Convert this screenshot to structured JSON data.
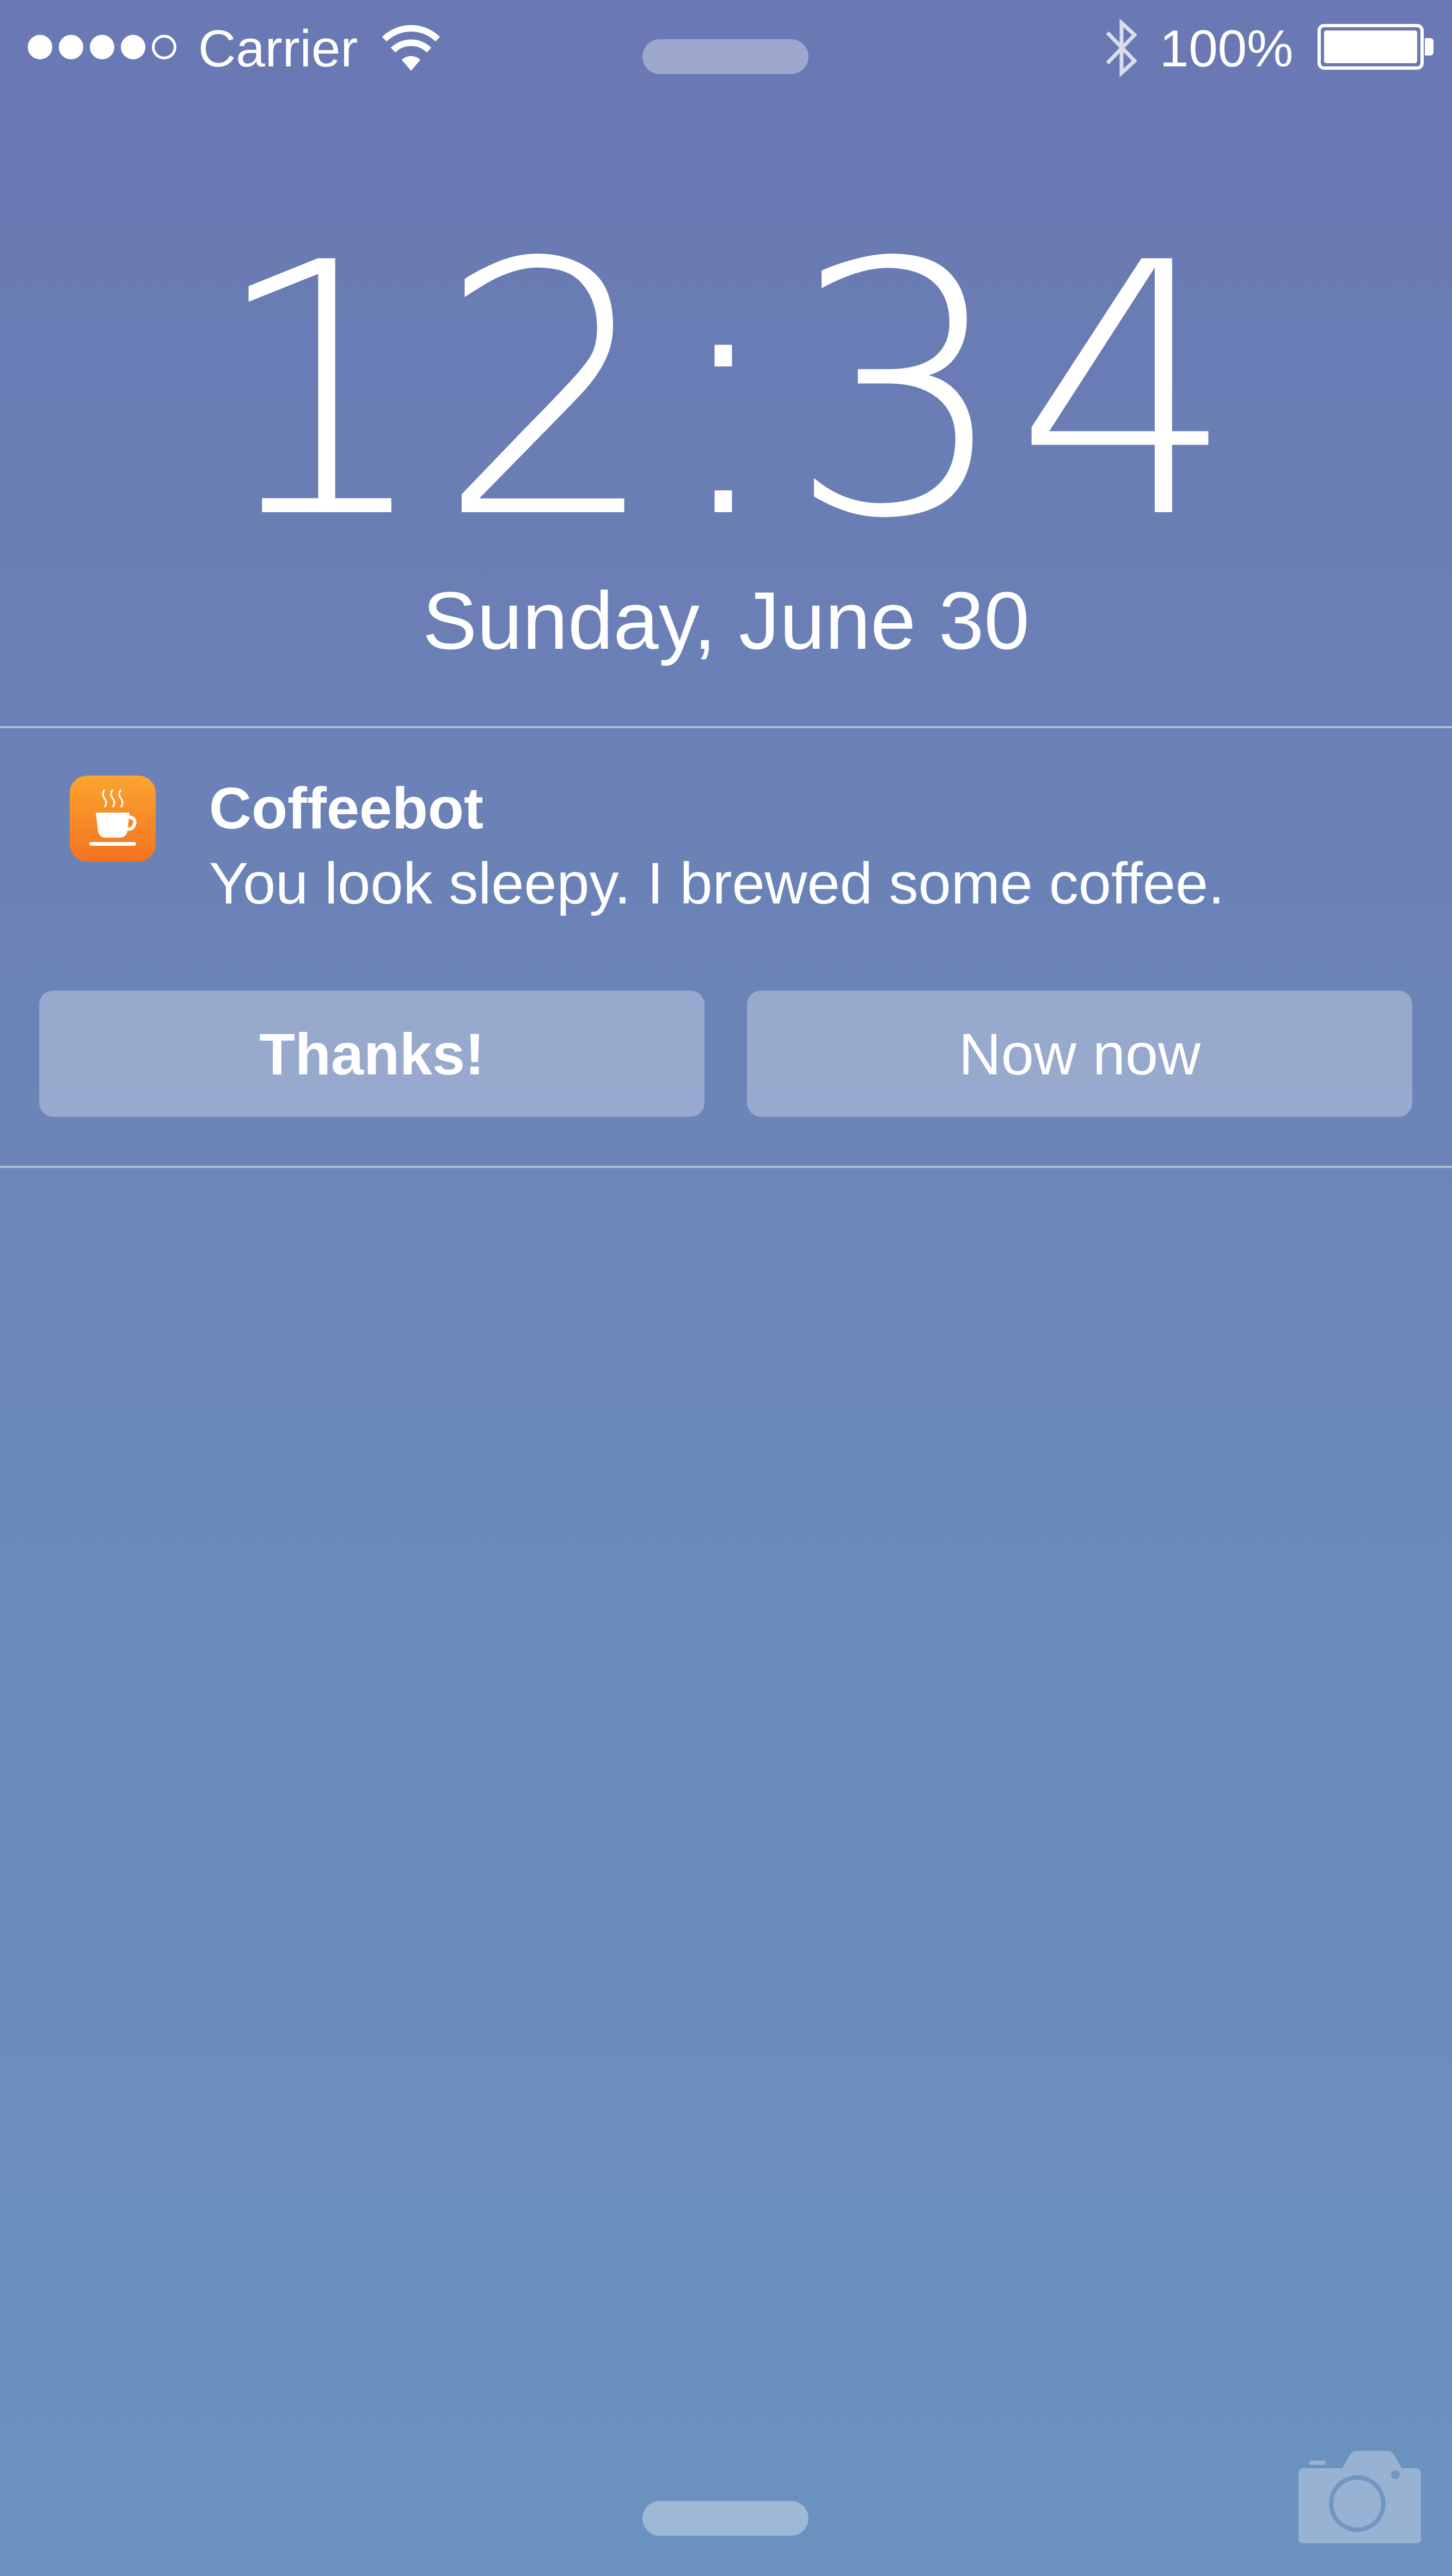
{
  "status_bar": {
    "signal_filled": 4,
    "signal_total": 5,
    "carrier": "Carrier",
    "battery_percent": "100%",
    "battery_level": 1.0
  },
  "lock_screen": {
    "time": "12:34",
    "date": "Sunday, June 30"
  },
  "notification": {
    "app_name": "Coffeebot",
    "message": "You look sleepy. I brewed some coffee.",
    "icon": "coffee-cup-icon",
    "actions": [
      {
        "label": "Thanks!"
      },
      {
        "label": "Now now"
      }
    ]
  },
  "icons": {
    "wifi": "wifi-icon",
    "bluetooth": "bluetooth-icon",
    "battery": "battery-icon",
    "camera": "camera-icon"
  },
  "colors": {
    "background_top": "#6a78b3",
    "background_bottom": "#6b92bf",
    "app_icon_top": "#fba530",
    "app_icon_bottom": "#f4721f"
  }
}
